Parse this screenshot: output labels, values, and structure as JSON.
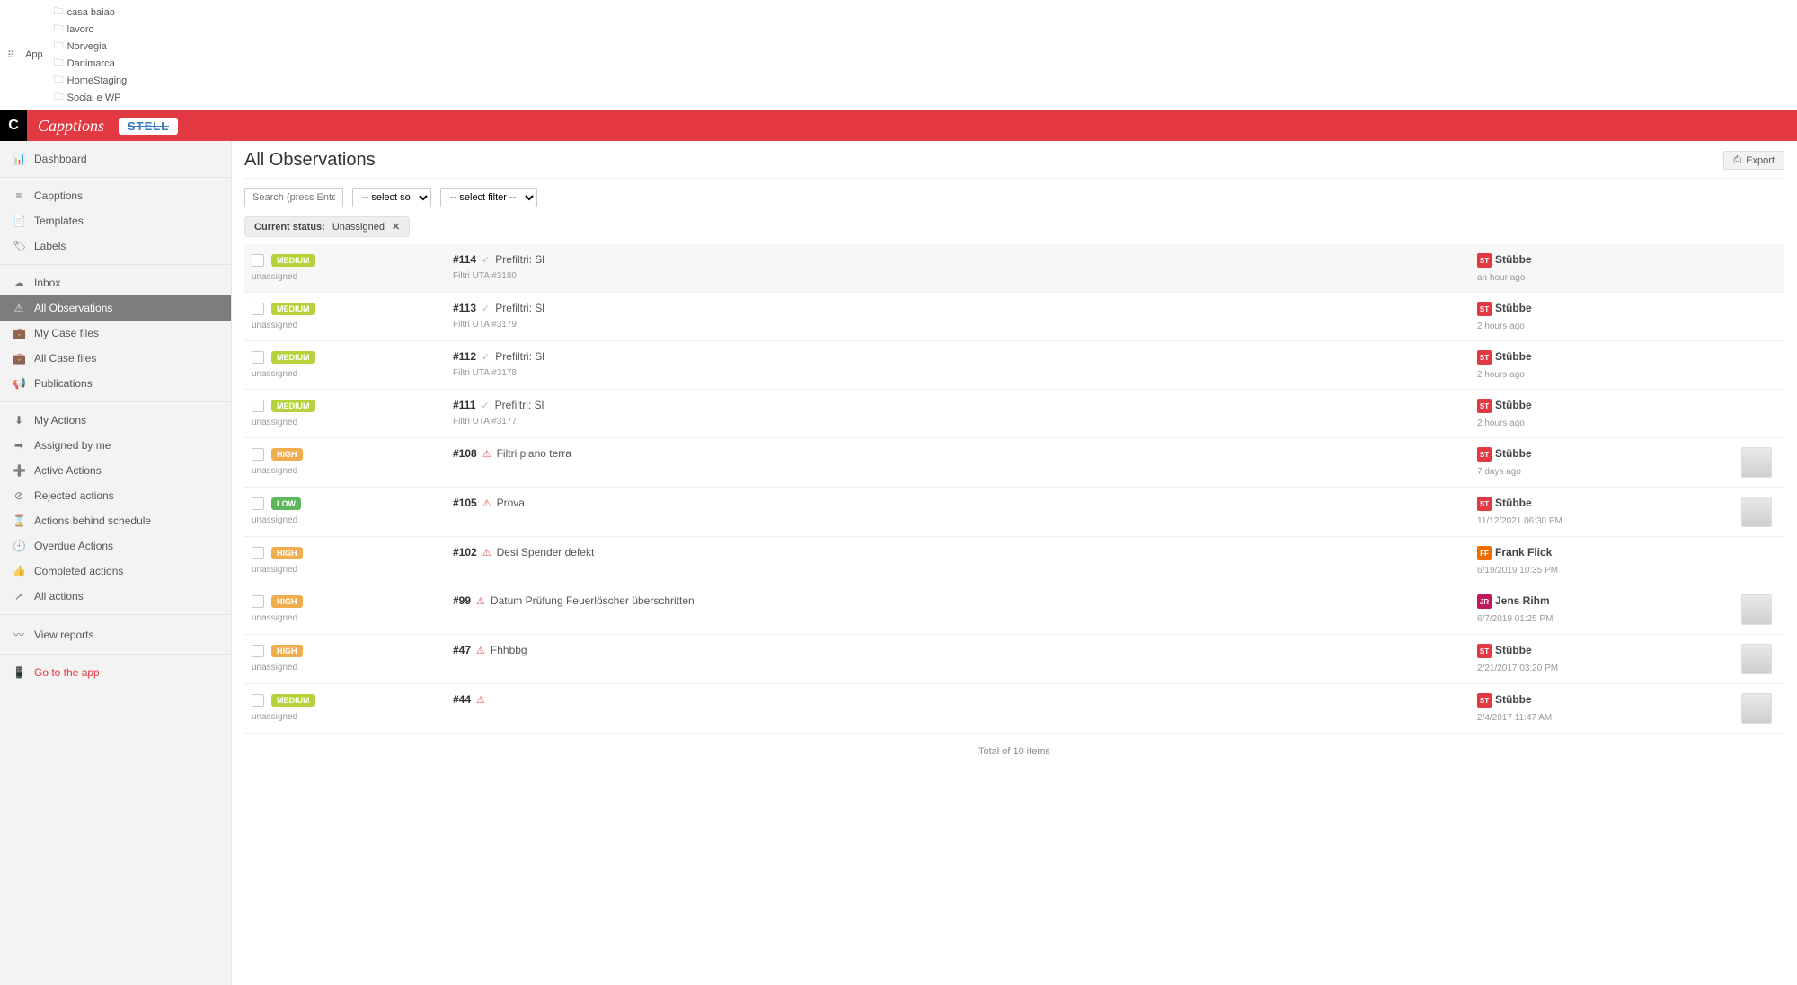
{
  "bookmarks": {
    "apps": "App",
    "items": [
      "casa baiao",
      "lavoro",
      "Norvegia",
      "Danimarca",
      "HomeStaging",
      "Social e WP"
    ]
  },
  "brand": {
    "mark": "C",
    "name": "Capptions",
    "partner": "STELL"
  },
  "sidebar": {
    "groups": [
      [
        {
          "icon": "📊",
          "label": "Dashboard"
        }
      ],
      [
        {
          "icon": "≡",
          "label": "Capptions"
        },
        {
          "icon": "📄",
          "label": "Templates"
        },
        {
          "icon": "🏷",
          "label": "Labels"
        }
      ],
      [
        {
          "icon": "☁",
          "label": "Inbox"
        },
        {
          "icon": "⚠",
          "label": "All Observations",
          "active": true
        },
        {
          "icon": "💼",
          "label": "My Case files"
        },
        {
          "icon": "💼",
          "label": "All Case files"
        },
        {
          "icon": "📢",
          "label": "Publications"
        }
      ],
      [
        {
          "icon": "⬇",
          "label": "My Actions"
        },
        {
          "icon": "➡",
          "label": "Assigned by me"
        },
        {
          "icon": "➕",
          "label": "Active Actions"
        },
        {
          "icon": "⊘",
          "label": "Rejected actions"
        },
        {
          "icon": "⌛",
          "label": "Actions behind schedule"
        },
        {
          "icon": "🕘",
          "label": "Overdue Actions"
        },
        {
          "icon": "👍",
          "label": "Completed actions"
        },
        {
          "icon": "↗",
          "label": "All actions"
        }
      ],
      [
        {
          "icon": "〰",
          "label": "View reports"
        }
      ],
      [
        {
          "icon": "📱",
          "label": "Go to the app",
          "red": true
        }
      ]
    ]
  },
  "page": {
    "title": "All Observations",
    "export": "Export",
    "search_placeholder": "Search (press Enter)",
    "select_sort": "-- select so",
    "select_filter": "-- select filter --",
    "chip_label": "Current status:",
    "chip_value": "Unassigned",
    "totals": "Total of 10 items"
  },
  "rows": [
    {
      "priority": "MEDIUM",
      "assigned": "unassigned",
      "id": "#114",
      "status": "ok",
      "title": "Prefiltri: Sl",
      "sub": "Filtri UTA #3180",
      "av": "ST",
      "author": "Stübbe",
      "when": "an hour ago",
      "thumb": false,
      "hl": true
    },
    {
      "priority": "MEDIUM",
      "assigned": "unassigned",
      "id": "#113",
      "status": "ok",
      "title": "Prefiltri: Sl",
      "sub": "Filtri UTA #3179",
      "av": "ST",
      "author": "Stübbe",
      "when": "2 hours ago",
      "thumb": false
    },
    {
      "priority": "MEDIUM",
      "assigned": "unassigned",
      "id": "#112",
      "status": "ok",
      "title": "Prefiltri: Sl",
      "sub": "Filtri UTA #3178",
      "av": "ST",
      "author": "Stübbe",
      "when": "2 hours ago",
      "thumb": false
    },
    {
      "priority": "MEDIUM",
      "assigned": "unassigned",
      "id": "#111",
      "status": "ok",
      "title": "Prefiltri: Sl",
      "sub": "Filtri UTA #3177",
      "av": "ST",
      "author": "Stübbe",
      "when": "2 hours ago",
      "thumb": false
    },
    {
      "priority": "HIGH",
      "assigned": "unassigned",
      "id": "#108",
      "status": "warn",
      "title": "Filtri piano terra",
      "sub": "",
      "av": "ST",
      "author": "Stübbe",
      "when": "7 days ago",
      "thumb": true
    },
    {
      "priority": "LOW",
      "assigned": "unassigned",
      "id": "#105",
      "status": "warn",
      "title": "Prova",
      "sub": "",
      "av": "ST",
      "author": "Stübbe",
      "when": "11/12/2021 06:30 PM",
      "thumb": true
    },
    {
      "priority": "HIGH",
      "assigned": "unassigned",
      "id": "#102",
      "status": "warn",
      "title": "Desi Spender defekt",
      "sub": "",
      "av": "FF",
      "avcls": "ff",
      "author": "Frank Flick",
      "when": "6/19/2019 10:35 PM",
      "thumb": false
    },
    {
      "priority": "HIGH",
      "assigned": "unassigned",
      "id": "#99",
      "status": "warn",
      "title": "Datum Prüfung Feuerlöscher überschritten",
      "sub": "",
      "av": "JR",
      "avcls": "jr",
      "author": "Jens Rihm",
      "when": "6/7/2019 01:25 PM",
      "thumb": true
    },
    {
      "priority": "HIGH",
      "assigned": "unassigned",
      "id": "#47",
      "status": "warn",
      "title": "Fhhbbg",
      "sub": "",
      "av": "ST",
      "author": "Stübbe",
      "when": "2/21/2017 03:20 PM",
      "thumb": true
    },
    {
      "priority": "MEDIUM",
      "assigned": "unassigned",
      "id": "#44",
      "status": "warn",
      "title": "",
      "sub": "",
      "av": "ST",
      "author": "Stübbe",
      "when": "2/4/2017 11:47 AM",
      "thumb": true
    }
  ]
}
